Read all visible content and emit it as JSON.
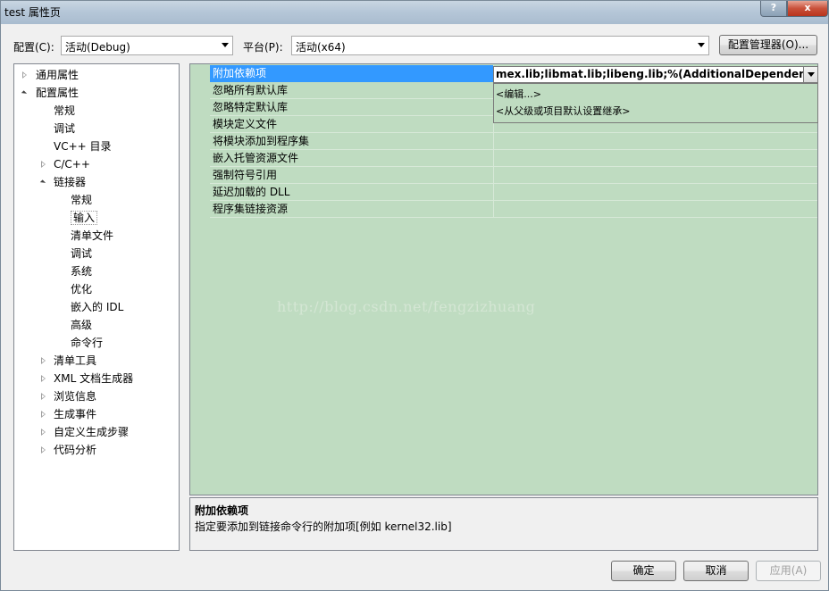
{
  "window": {
    "title": "test 属性页",
    "help_glyph": "?",
    "close_glyph": "x"
  },
  "toolbar": {
    "config_label": "配置(C):",
    "config_value": "活动(Debug)",
    "platform_label": "平台(P):",
    "platform_value": "活动(x64)",
    "config_manager_button": "配置管理器(O)..."
  },
  "tree": [
    {
      "label": "通用属性",
      "level": 0,
      "state": "collapsed"
    },
    {
      "label": "配置属性",
      "level": 0,
      "state": "expanded"
    },
    {
      "label": "常规",
      "level": 1,
      "state": "leaf"
    },
    {
      "label": "调试",
      "level": 1,
      "state": "leaf"
    },
    {
      "label": "VC++ 目录",
      "level": 1,
      "state": "leaf"
    },
    {
      "label": "C/C++",
      "level": 1,
      "state": "collapsed"
    },
    {
      "label": "链接器",
      "level": 1,
      "state": "expanded"
    },
    {
      "label": "常规",
      "level": 2,
      "state": "leaf"
    },
    {
      "label": "输入",
      "level": 2,
      "state": "leaf",
      "selected": true
    },
    {
      "label": "清单文件",
      "level": 2,
      "state": "leaf"
    },
    {
      "label": "调试",
      "level": 2,
      "state": "leaf"
    },
    {
      "label": "系统",
      "level": 2,
      "state": "leaf"
    },
    {
      "label": "优化",
      "level": 2,
      "state": "leaf"
    },
    {
      "label": "嵌入的 IDL",
      "level": 2,
      "state": "leaf"
    },
    {
      "label": "高级",
      "level": 2,
      "state": "leaf"
    },
    {
      "label": "命令行",
      "level": 2,
      "state": "leaf"
    },
    {
      "label": "清单工具",
      "level": 1,
      "state": "collapsed"
    },
    {
      "label": "XML 文档生成器",
      "level": 1,
      "state": "collapsed"
    },
    {
      "label": "浏览信息",
      "level": 1,
      "state": "collapsed"
    },
    {
      "label": "生成事件",
      "level": 1,
      "state": "collapsed"
    },
    {
      "label": "自定义生成步骤",
      "level": 1,
      "state": "collapsed"
    },
    {
      "label": "代码分析",
      "level": 1,
      "state": "collapsed"
    }
  ],
  "grid": {
    "rows": [
      {
        "name": "附加依赖项",
        "selected": true
      },
      {
        "name": "忽略所有默认库"
      },
      {
        "name": "忽略特定默认库"
      },
      {
        "name": "模块定义文件"
      },
      {
        "name": "将模块添加到程序集"
      },
      {
        "name": "嵌入托管资源文件"
      },
      {
        "name": "强制符号引用"
      },
      {
        "name": "延迟加载的 DLL"
      },
      {
        "name": "程序集链接资源"
      }
    ],
    "selected_value": "mex.lib;libmat.lib;libeng.lib;%(AdditionalDependencies)",
    "dropdown_items": [
      "<编辑...>",
      "<从父级或项目默认设置继承>"
    ],
    "watermark": "http://blog.csdn.net/fengzizhuang"
  },
  "description": {
    "title": "附加依赖项",
    "text": "指定要添加到链接命令行的附加项[例如 kernel32.lib]"
  },
  "footer": {
    "ok": "确定",
    "cancel": "取消",
    "apply": "应用(A)"
  }
}
